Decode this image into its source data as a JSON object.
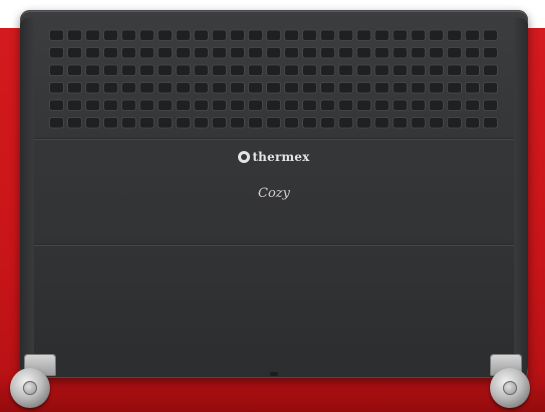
{
  "image": {
    "subject": "convector-heater",
    "colors": {
      "background_red": "#c81519",
      "heater_body": "#363739",
      "grille_slot": "#1f2022",
      "logo_text": "#e4e4e4",
      "wheel": "#bdbdbd"
    }
  },
  "heater": {
    "brand_name": "thermex",
    "model_script": "Cozy",
    "brand_icon": "thermex-logo-icon"
  },
  "grille": {
    "rows": 6,
    "columns": 25
  }
}
